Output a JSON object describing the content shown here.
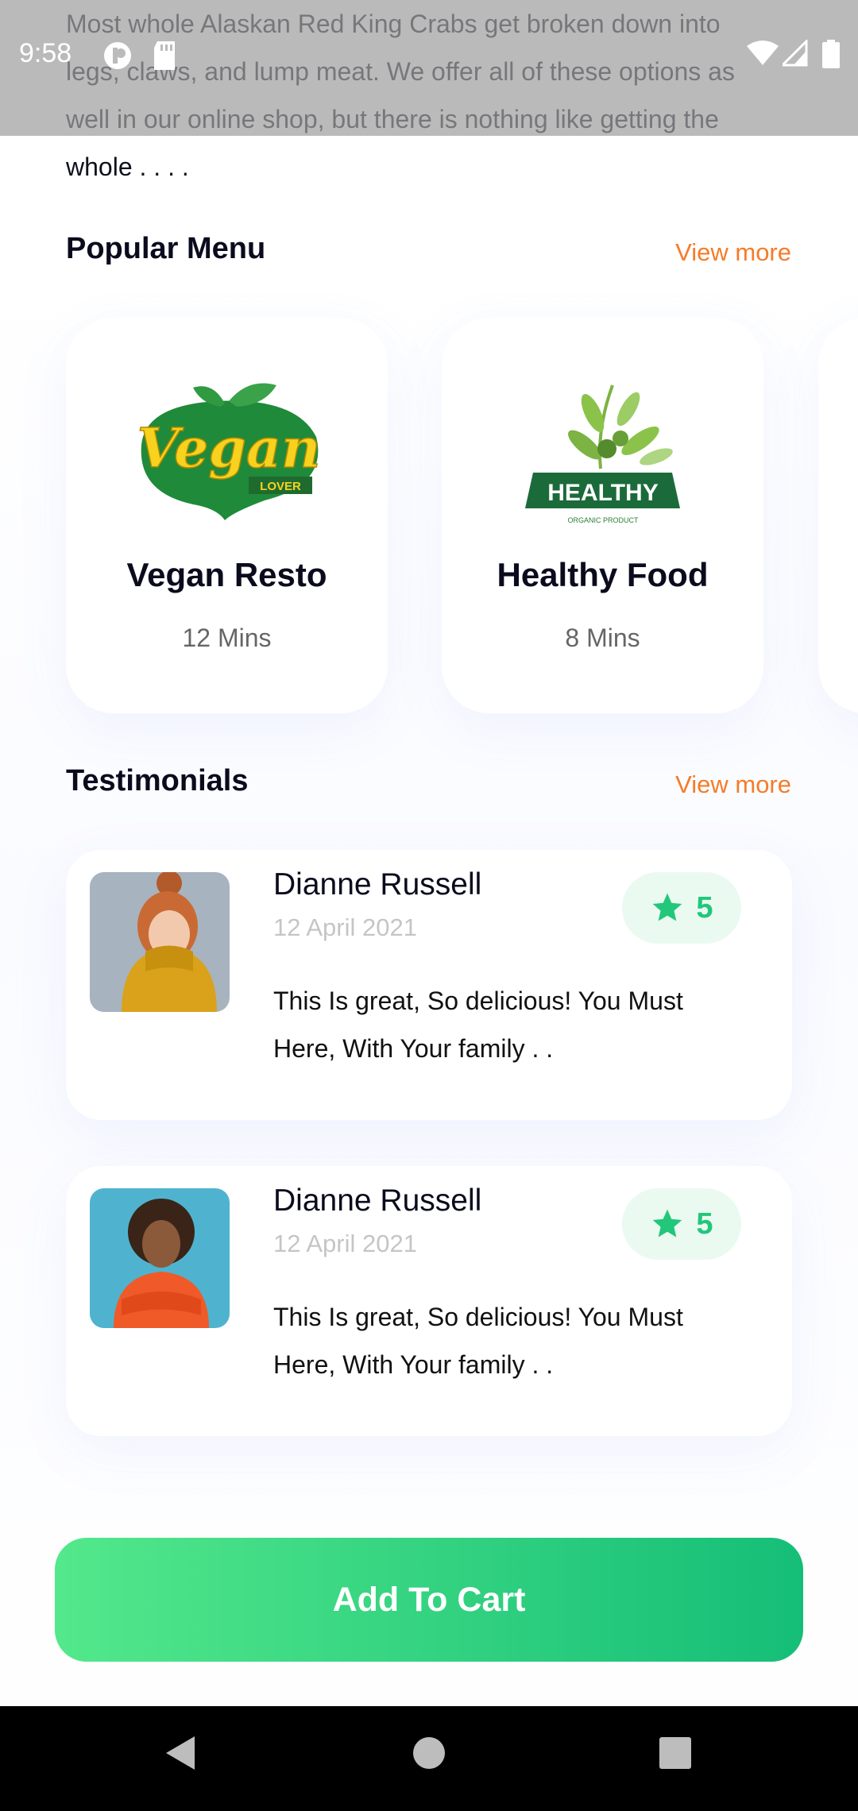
{
  "status": {
    "time": "9:58"
  },
  "description": "Most whole Alaskan Red King Crabs get broken down into legs, claws, and lump meat. We offer all of these options as well in our online shop, but there is nothing like getting the whole . . . .",
  "popular": {
    "title": "Popular Menu",
    "view_more": "View more",
    "items": [
      {
        "name": "Vegan Resto",
        "time": "12 Mins",
        "logo_text": "Vegan",
        "logo_sub": "LOVER"
      },
      {
        "name": "Healthy Food",
        "time": "8 Mins",
        "logo_text": "HEALTHY",
        "logo_sub": "ORGANIC PRODUCT"
      }
    ]
  },
  "testimonials": {
    "title": "Testimonials",
    "view_more": "View more",
    "items": [
      {
        "name": "Dianne Russell",
        "date": "12 April 2021",
        "rating": "5",
        "text": "This Is great, So delicious! You Must Here, With Your family . ."
      },
      {
        "name": "Dianne Russell",
        "date": "12 April 2021",
        "rating": "5",
        "text": "This Is great, So delicious! You Must Here, With Your family . ."
      }
    ]
  },
  "cart": {
    "label": "Add To Cart"
  },
  "colors": {
    "accent": "#f57c2a",
    "green": "#22c77a",
    "button_start": "#53e88b",
    "button_end": "#15be77"
  },
  "icons": [
    "wifi-icon",
    "signal-icon",
    "battery-icon",
    "star-icon",
    "back-icon",
    "home-icon",
    "recents-icon"
  ]
}
